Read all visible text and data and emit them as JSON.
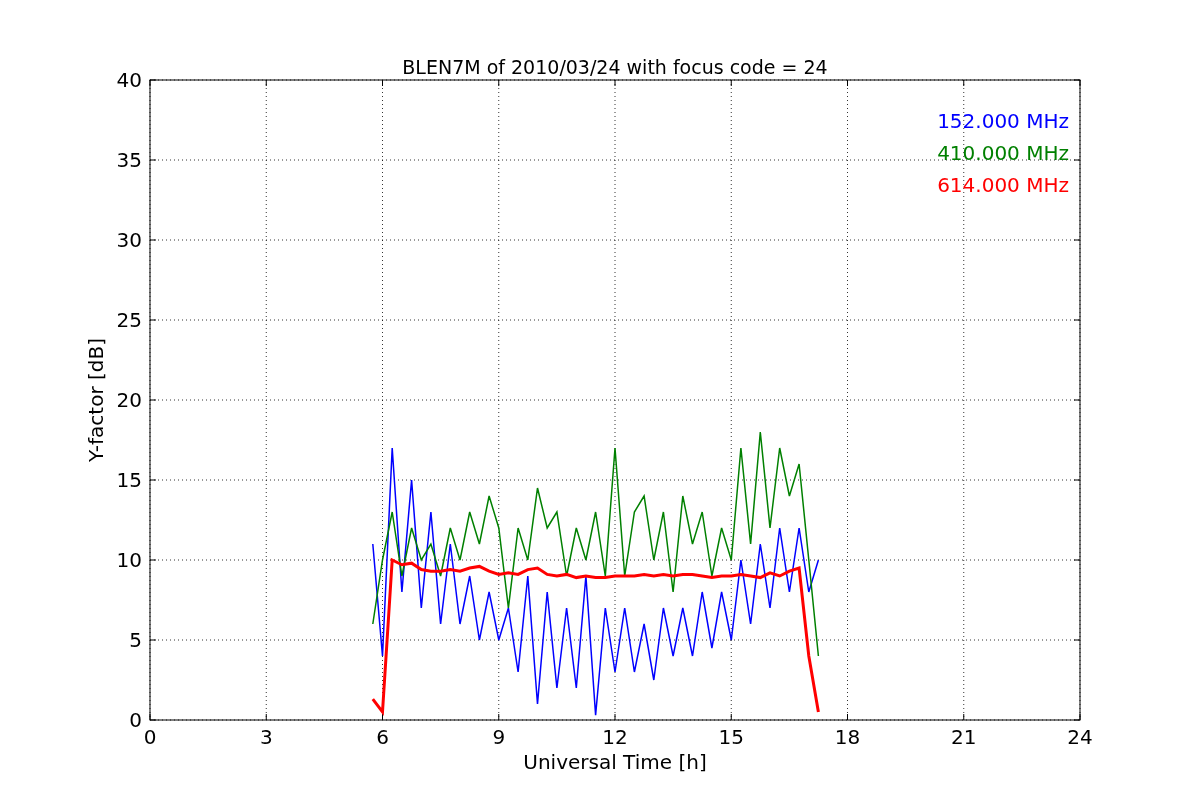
{
  "chart_data": {
    "type": "line",
    "title": "BLEN7M of 2010/03/24 with focus code = 24",
    "xlabel": "Universal Time [h]",
    "ylabel": "Y-factor [dB]",
    "x": [
      5.75,
      6.0,
      6.25,
      6.5,
      6.75,
      7.0,
      7.25,
      7.5,
      7.75,
      8.0,
      8.25,
      8.5,
      8.75,
      9.0,
      9.25,
      9.5,
      9.75,
      10.0,
      10.25,
      10.5,
      10.75,
      11.0,
      11.25,
      11.5,
      11.75,
      12.0,
      12.25,
      12.5,
      12.75,
      13.0,
      13.25,
      13.5,
      13.75,
      14.0,
      14.25,
      14.5,
      14.75,
      15.0,
      15.25,
      15.5,
      15.75,
      16.0,
      16.25,
      16.5,
      16.75,
      17.0,
      17.25
    ],
    "series": [
      {
        "name": "152.000 MHz",
        "color": "#0000ff",
        "values": [
          11,
          4,
          17,
          8,
          15,
          7,
          13,
          6,
          11,
          6,
          9,
          5,
          8,
          5,
          7,
          3,
          9,
          1,
          8,
          2,
          7,
          2,
          9,
          0.3,
          7,
          3,
          7,
          3,
          6,
          2.5,
          7,
          4,
          7,
          4,
          8,
          4.5,
          8,
          5,
          10,
          6,
          11,
          7,
          12,
          8,
          12,
          8,
          10
        ]
      },
      {
        "name": "410.000 MHz",
        "color": "#008000",
        "values": [
          6,
          10,
          13,
          9,
          12,
          10,
          11,
          9,
          12,
          10,
          13,
          11,
          14,
          12,
          7,
          12,
          10,
          14.5,
          12,
          13,
          9,
          12,
          10,
          13,
          9,
          17,
          9,
          13,
          14,
          10,
          13,
          8,
          14,
          11,
          13,
          9,
          12,
          10,
          17,
          11,
          18,
          12,
          17,
          14,
          16,
          10,
          4
        ]
      },
      {
        "name": "614.000 MHz",
        "color": "#ff0000",
        "values": [
          1.3,
          0.5,
          10,
          9.7,
          9.8,
          9.4,
          9.3,
          9.3,
          9.4,
          9.3,
          9.5,
          9.6,
          9.3,
          9.1,
          9.2,
          9.1,
          9.4,
          9.5,
          9.1,
          9.0,
          9.1,
          8.9,
          9.0,
          8.9,
          8.9,
          9.0,
          9.0,
          9.0,
          9.1,
          9.0,
          9.1,
          9.0,
          9.1,
          9.1,
          9.0,
          8.9,
          9.0,
          9.0,
          9.1,
          9.0,
          8.9,
          9.2,
          9.0,
          9.3,
          9.5,
          4,
          0.5
        ]
      }
    ],
    "xlim": [
      0,
      24
    ],
    "ylim": [
      0,
      40
    ],
    "xticks": [
      0,
      3,
      6,
      9,
      12,
      15,
      18,
      21,
      24
    ],
    "yticks": [
      0,
      5,
      10,
      15,
      20,
      25,
      30,
      35,
      40
    ],
    "grid": true
  }
}
